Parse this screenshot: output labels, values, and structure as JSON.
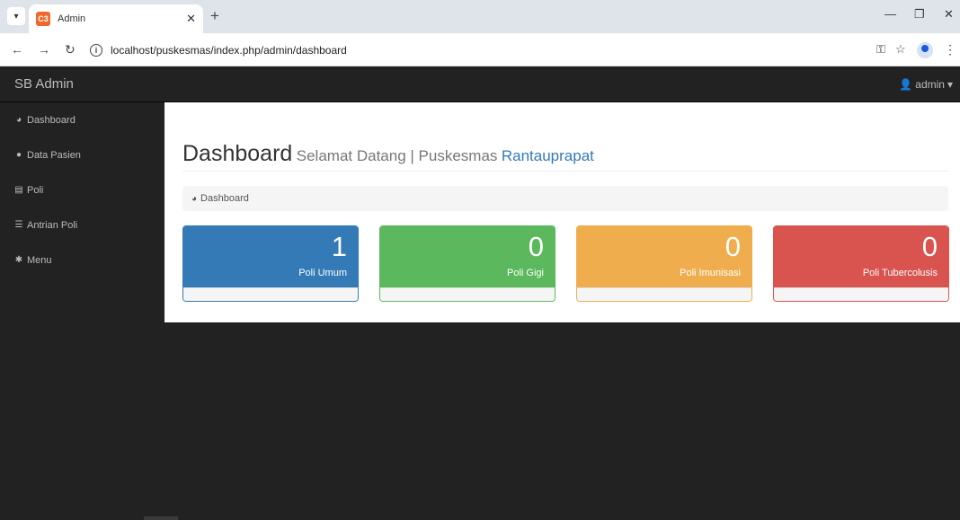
{
  "browser": {
    "tab_title": "Admin",
    "favicon_text": "C3",
    "url": "localhost/puskesmas/index.php/admin/dashboard",
    "icons": [
      "tab-list-icon",
      "close-icon",
      "new-tab-icon",
      "minimize-icon",
      "restore-icon",
      "close-window-icon",
      "back-icon",
      "forward-icon",
      "reload-icon",
      "info-icon",
      "password-key-icon",
      "star-icon",
      "profile-icon",
      "menu-dots-icon"
    ]
  },
  "navbar": {
    "brand": "SB Admin",
    "user": "admin"
  },
  "sidebar": {
    "items": [
      {
        "label": "Dashboard",
        "icon": "dashboard-icon"
      },
      {
        "label": "Data Pasien",
        "icon": "user-icon"
      },
      {
        "label": "Poli",
        "icon": "list-alt-icon"
      },
      {
        "label": "Antrian Poli",
        "icon": "list-icon"
      },
      {
        "label": "Menu",
        "icon": "cog-icon"
      }
    ]
  },
  "header": {
    "title": "Dashboard",
    "subtitle": "Selamat Datang | Puskesmas",
    "link": "Rantauprapat"
  },
  "breadcrumb": {
    "label": "Dashboard",
    "icon": "dashboard-icon"
  },
  "panels": [
    {
      "count": "1",
      "label": "Poli Umum",
      "color": "#337ab7"
    },
    {
      "count": "0",
      "label": "Poli Gigi",
      "color": "#5cb85c"
    },
    {
      "count": "0",
      "label": "Poli Imunisasi",
      "color": "#f0ad4e"
    },
    {
      "count": "0",
      "label": "Poli Tubercolusis",
      "color": "#d9534f"
    }
  ]
}
